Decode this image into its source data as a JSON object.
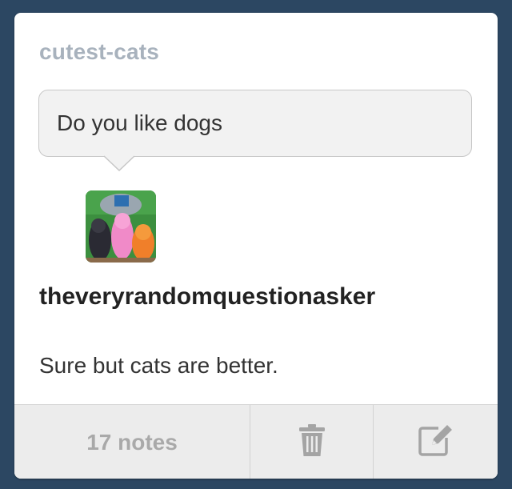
{
  "post": {
    "blog_name": "cutest-cats",
    "question": "Do you like dogs",
    "asker": {
      "username": "theveryrandomquestionasker",
      "avatar_icon": "avatar-image"
    },
    "answer": "Sure but cats are better."
  },
  "footer": {
    "notes_label": "17 notes",
    "delete_icon": "trash-icon",
    "edit_icon": "edit-icon"
  },
  "colors": {
    "background": "#2c4762",
    "card": "#ffffff",
    "blog_name": "#a8b2bd",
    "bubble": "#f2f2f2",
    "footer": "#ececec",
    "footer_text": "#a9a9a9"
  }
}
